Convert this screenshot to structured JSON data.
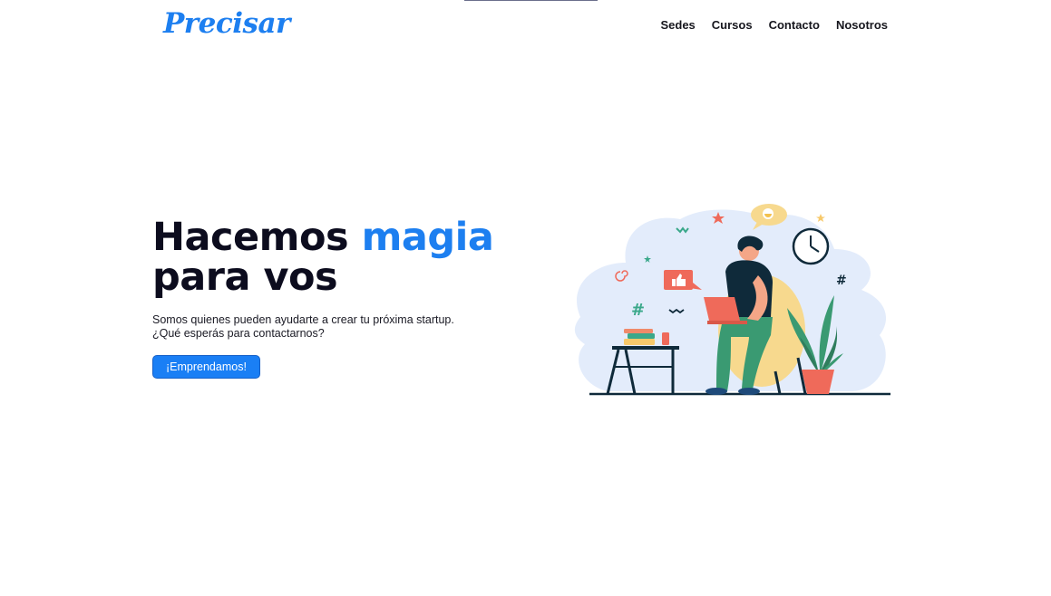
{
  "brand": {
    "logo": "Precisar",
    "color": "#1d7ff0"
  },
  "nav": {
    "items": [
      "Sedes",
      "Cursos",
      "Contacto",
      "Nosotros"
    ]
  },
  "hero": {
    "title_part1": "Hacemos ",
    "title_accent": "magia",
    "title_part2": "para vos",
    "line1": "Somos quienes pueden ayudarte a crear tu próxima startup.",
    "line2": "¿Qué esperás para contactarnos?",
    "cta": "¡Emprendamos!"
  },
  "illustration": {
    "subject": "person-working-on-laptop-in-armchair"
  }
}
